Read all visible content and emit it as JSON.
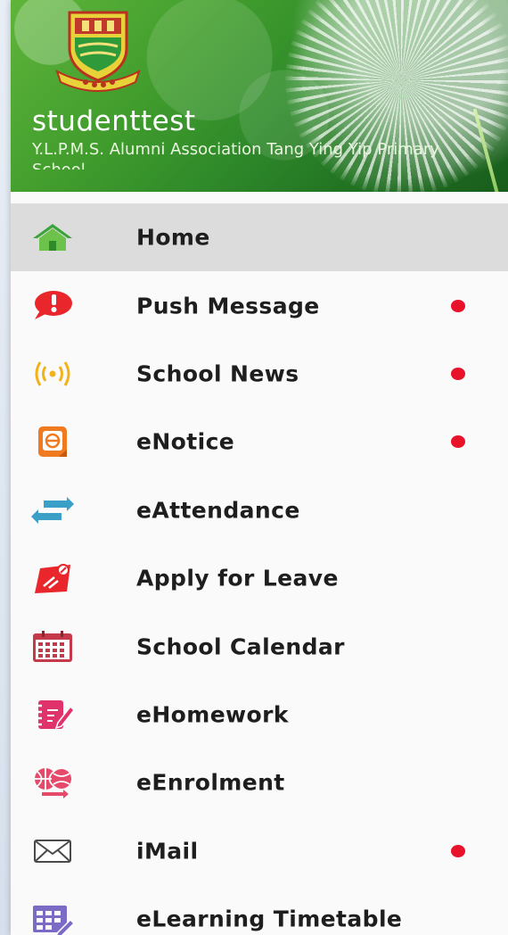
{
  "header": {
    "user_name": "studenttest",
    "school_name": "Y.L.P.M.S. Alumni Association Tang Ying Yip Primary School"
  },
  "menu": {
    "items": [
      {
        "label": "Home",
        "icon": "home-icon",
        "active": true,
        "badge": false
      },
      {
        "label": "Push Message",
        "icon": "push-message-icon",
        "active": false,
        "badge": true
      },
      {
        "label": "School News",
        "icon": "broadcast-icon",
        "active": false,
        "badge": true
      },
      {
        "label": "eNotice",
        "icon": "notice-icon",
        "active": false,
        "badge": true
      },
      {
        "label": "eAttendance",
        "icon": "swap-arrows-icon",
        "active": false,
        "badge": false
      },
      {
        "label": "Apply for Leave",
        "icon": "leave-icon",
        "active": false,
        "badge": false
      },
      {
        "label": "School Calendar",
        "icon": "calendar-icon",
        "active": false,
        "badge": false
      },
      {
        "label": "eHomework",
        "icon": "homework-icon",
        "active": false,
        "badge": false
      },
      {
        "label": "eEnrolment",
        "icon": "enrolment-icon",
        "active": false,
        "badge": false
      },
      {
        "label": "iMail",
        "icon": "mail-icon",
        "active": false,
        "badge": true
      },
      {
        "label": "eLearning Timetable",
        "icon": "timetable-icon",
        "active": false,
        "badge": false
      }
    ]
  },
  "colors": {
    "badge": "#e8132b",
    "active_row": "#dcdcdc",
    "header_green": "#3f9b2c"
  }
}
